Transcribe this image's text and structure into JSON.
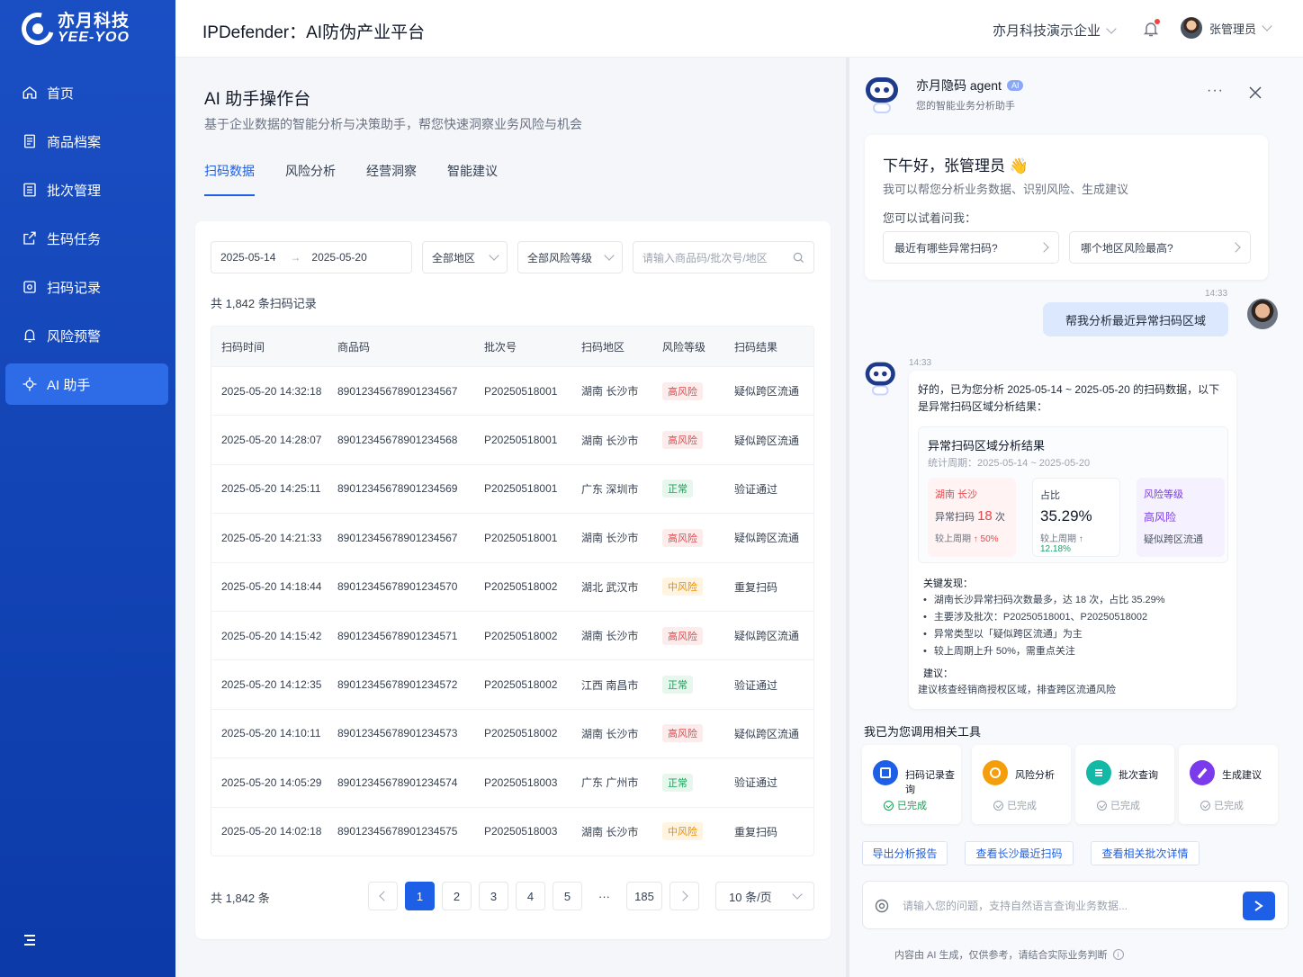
{
  "brand": {
    "logo_cn": "亦月科技",
    "logo_en": "YEE-YOO"
  },
  "sidebar": {
    "items": [
      {
        "label": "首页",
        "icon": "home-icon"
      },
      {
        "label": "商品档案",
        "icon": "file-icon"
      },
      {
        "label": "批次管理",
        "icon": "batch-icon"
      },
      {
        "label": "生码任务",
        "icon": "task-icon"
      },
      {
        "label": "扫码记录",
        "icon": "scan-icon"
      },
      {
        "label": "风险预警",
        "icon": "warning-icon"
      },
      {
        "label": "AI 助手",
        "icon": "ai-icon"
      }
    ],
    "active": "AI 助手"
  },
  "topbar": {
    "title": "IPDefender：AI防伪产业平台",
    "org": "亦月科技演示企业",
    "user": "张管理员"
  },
  "main": {
    "title": "AI 助手操作台",
    "subtitle": "基于企业数据的智能分析与决策助手，帮您快速洞察业务风险与机会",
    "tabs": [
      "扫码数据",
      "风险分析",
      "经营洞察",
      "智能建议"
    ],
    "filters": {
      "date_start": "2025-05-14",
      "date_end": "2025-05-20",
      "region": "全部地区",
      "risk": "全部风险等级",
      "search_placeholder": "请输入商品码/批次号/地区"
    },
    "count_text": "共 1,842 条扫码记录",
    "columns": [
      "扫码时间",
      "商品码",
      "批次号",
      "扫码地区",
      "风险等级",
      "扫码结果"
    ],
    "rows": [
      [
        "2025-05-20 14:32:18",
        "89012345678901234567",
        "P20250518001",
        "湖南 长沙市",
        "高风险",
        "疑似跨区流通"
      ],
      [
        "2025-05-20 14:28:07",
        "89012345678901234568",
        "P20250518001",
        "湖南 长沙市",
        "高风险",
        "疑似跨区流通"
      ],
      [
        "2025-05-20 14:25:11",
        "89012345678901234569",
        "P20250518001",
        "广东 深圳市",
        "正常",
        "验证通过"
      ],
      [
        "2025-05-20 14:21:33",
        "89012345678901234567",
        "P20250518001",
        "湖南 长沙市",
        "高风险",
        "疑似跨区流通"
      ],
      [
        "2025-05-20 14:18:44",
        "89012345678901234570",
        "P20250518002",
        "湖北 武汉市",
        "中风险",
        "重复扫码"
      ],
      [
        "2025-05-20 14:15:42",
        "89012345678901234571",
        "P20250518002",
        "湖南 长沙市",
        "高风险",
        "疑似跨区流通"
      ],
      [
        "2025-05-20 14:12:35",
        "89012345678901234572",
        "P20250518002",
        "江西 南昌市",
        "正常",
        "验证通过"
      ],
      [
        "2025-05-20 14:10:11",
        "89012345678901234573",
        "P20250518002",
        "湖南 长沙市",
        "高风险",
        "疑似跨区流通"
      ],
      [
        "2025-05-20 14:05:29",
        "89012345678901234574",
        "P20250518003",
        "广东 广州市",
        "正常",
        "验证通过"
      ],
      [
        "2025-05-20 14:02:18",
        "89012345678901234575",
        "P20250518003",
        "湖南 长沙市",
        "中风险",
        "重复扫码"
      ]
    ],
    "pager": {
      "total": "共 1,842 条",
      "pages": [
        "1",
        "2",
        "3",
        "4",
        "5",
        "···",
        "185"
      ],
      "current": "1",
      "page_size": "10 条/页"
    }
  },
  "chat": {
    "agent_name": "亦月隐码 agent",
    "agent_tag": "AI",
    "agent_sub": "您的智能业务分析助手",
    "greet_title": "下午好，张管理员 👋",
    "greet_sub": "我可以帮您分析业务数据、识别风险、生成建议",
    "try_label": "您可以试着问我：",
    "questions": [
      "最近有哪些异常扫码?",
      "哪个地区风险最高?"
    ],
    "user_time": "14:33",
    "user_msg": "帮我分析最近异常扫码区域",
    "bot_time": "14:33",
    "answer_intro": "好的，已为您分析 2025-05-14 ~ 2025-05-20 的扫码数据，以下是异常扫码区域分析结果：",
    "box_title": "异常扫码区域分析结果",
    "box_sub": "统计周期：2025-05-14 ~ 2025-05-20",
    "m1": {
      "label": "湖南 长沙",
      "pre": "异常扫码",
      "num": "18",
      "unit": "次",
      "foot_label": "较上周期",
      "foot_val": "↑ 50%"
    },
    "m2": {
      "label": "占比",
      "value": "35.29%",
      "foot_label": "较上周期",
      "foot_val": "↑ 12.18%"
    },
    "m3": {
      "label": "风险等级",
      "value": "高风险",
      "desc": "疑似跨区流通"
    },
    "key_title": "关键发现：",
    "findings": [
      "湖南长沙异常扫码次数最多，达 18 次，占比 35.29%",
      "主要涉及批次：P20250518001、P20250518002",
      "异常类型以「疑似跨区流通」为主",
      "较上周期上升 50%，需重点关注"
    ],
    "advice_title": "建议：",
    "advice": "建议核查经销商授权区域，排查跨区流通风险",
    "tools_title": "我已为您调用相关工具",
    "tools": [
      {
        "name": "扫码记录查询",
        "status": "已完成",
        "color": "#1d5fe6"
      },
      {
        "name": "风险分析",
        "status": "已完成",
        "color": "#f59e0b"
      },
      {
        "name": "批次查询",
        "status": "已完成",
        "color": "#14b8a6"
      },
      {
        "name": "生成建议",
        "status": "已完成",
        "color": "#7c3aed"
      }
    ],
    "actions": [
      "导出分析报告",
      "查看长沙最近扫码",
      "查看相关批次详情"
    ],
    "input_placeholder": "请输入您的问题，支持自然语言查询业务数据...",
    "disclaimer": "内容由 AI 生成，仅供参考，请结合实际业务判断"
  }
}
